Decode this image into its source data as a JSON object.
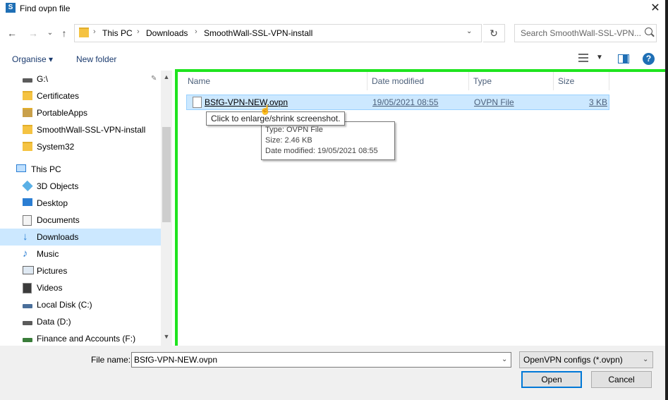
{
  "window": {
    "title": "Find ovpn file",
    "app_icon": "S"
  },
  "nav_buttons": {
    "back": "←",
    "forward": "→",
    "recent": "⌄",
    "up": "↑"
  },
  "address": {
    "crumbs": [
      "This PC",
      "Downloads",
      "SmoothWall-SSL-VPN-install"
    ],
    "separator": "›"
  },
  "search": {
    "placeholder": "Search SmoothWall-SSL-VPN..."
  },
  "toolbar": {
    "organise": "Organise ▾",
    "new_folder": "New folder",
    "help": "?"
  },
  "nav_pane": {
    "pinned": [
      {
        "label": "G:\\",
        "icon": "drive-icon"
      },
      {
        "label": "Certificates",
        "icon": "folder-icon"
      },
      {
        "label": "PortableApps",
        "icon": "folder-icon"
      },
      {
        "label": "SmoothWall-SSL-VPN-install",
        "icon": "folder-icon"
      },
      {
        "label": "System32",
        "icon": "folder-icon"
      }
    ],
    "this_pc": "This PC",
    "pc_items": [
      {
        "label": "3D Objects",
        "icon": "3d-objects-icon"
      },
      {
        "label": "Desktop",
        "icon": "desktop-icon"
      },
      {
        "label": "Documents",
        "icon": "documents-icon"
      },
      {
        "label": "Downloads",
        "icon": "downloads-icon"
      },
      {
        "label": "Music",
        "icon": "music-icon"
      },
      {
        "label": "Pictures",
        "icon": "pictures-icon"
      },
      {
        "label": "Videos",
        "icon": "videos-icon"
      },
      {
        "label": "Local Disk (C:)",
        "icon": "drive-icon"
      },
      {
        "label": "Data (D:)",
        "icon": "drive-icon"
      },
      {
        "label": "Finance and Accounts (F:)",
        "icon": "network-drive-icon"
      }
    ],
    "selected": "Downloads"
  },
  "columns": {
    "name": "Name",
    "date": "Date modified",
    "type": "Type",
    "size": "Size"
  },
  "files": [
    {
      "name": "BSfG-VPN-NEW.ovpn",
      "date": "19/05/2021 08:55",
      "type": "OVPN File",
      "size": "3 KB"
    }
  ],
  "tooltip_enlarge": "Click to enlarge/shrink screenshot.",
  "tooltip_info": {
    "type": "Type: OVPN File",
    "size": "Size: 2.46 KB",
    "date": "Date modified: 19/05/2021 08:55"
  },
  "bottom": {
    "file_name_label": "File name:",
    "file_name_value": "BSfG-VPN-NEW.ovpn",
    "filter": "OpenVPN configs (*.ovpn)",
    "open": "Open",
    "cancel": "Cancel"
  },
  "colors": {
    "accent": "#1f6fb5",
    "highlight_border": "#1fe41f",
    "selection": "#cce8ff"
  }
}
